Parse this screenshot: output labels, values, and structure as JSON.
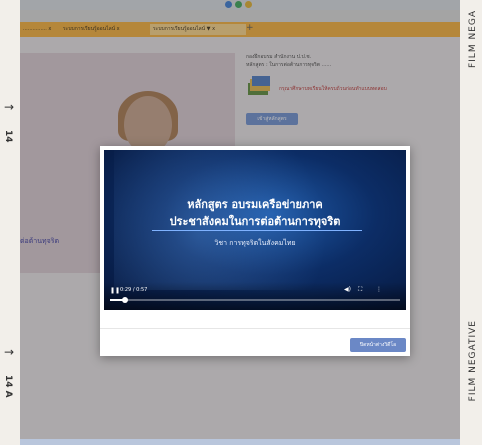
{
  "film": {
    "right_top": "FILM NEGA",
    "right_bottom": "FILM NEGATIVE",
    "left_top": "14",
    "left_bottom": "14 A",
    "arrow": "→"
  },
  "browser": {
    "tabs": [
      {
        "label": "...............  x",
        "active": false
      },
      {
        "label": "ระบบการเรียนรู้ออนไลน์ x",
        "active": false
      },
      {
        "label": "ระบบการเรียนรู้ออนไลน์ ▼ x",
        "active": true
      }
    ],
    "new_tab": "+"
  },
  "page": {
    "info_line1": "กองฝึกอบรม สำนักงาน ป.ป.ช.",
    "info_line2": "หลักสูตร : ในการต่อต้านการทุจริต ......",
    "warning": "กรุณาศึกษาบทเรียนให้ครบถ้วนก่อนทำแบบทดสอบ",
    "start_button": "เข้าสู่หลักสูตร",
    "hero_link": "ต่อต้านทุจริต"
  },
  "video": {
    "title1": "หลักสูตร อบรมเครือข่ายภาค",
    "title2": "ประชาสังคมในการต่อต้านการทุจริต",
    "subtitle": "วิชา การทุจริตในสังคมไทย",
    "time": "0:29 / 0:57",
    "progress": 0.05
  },
  "modal": {
    "close_label": "ปิดหน้าต่างวิดีโอ"
  },
  "colors": {
    "tabbar": "#f6b03a",
    "button": "#6b88c6",
    "video_dark": "#06163a"
  }
}
